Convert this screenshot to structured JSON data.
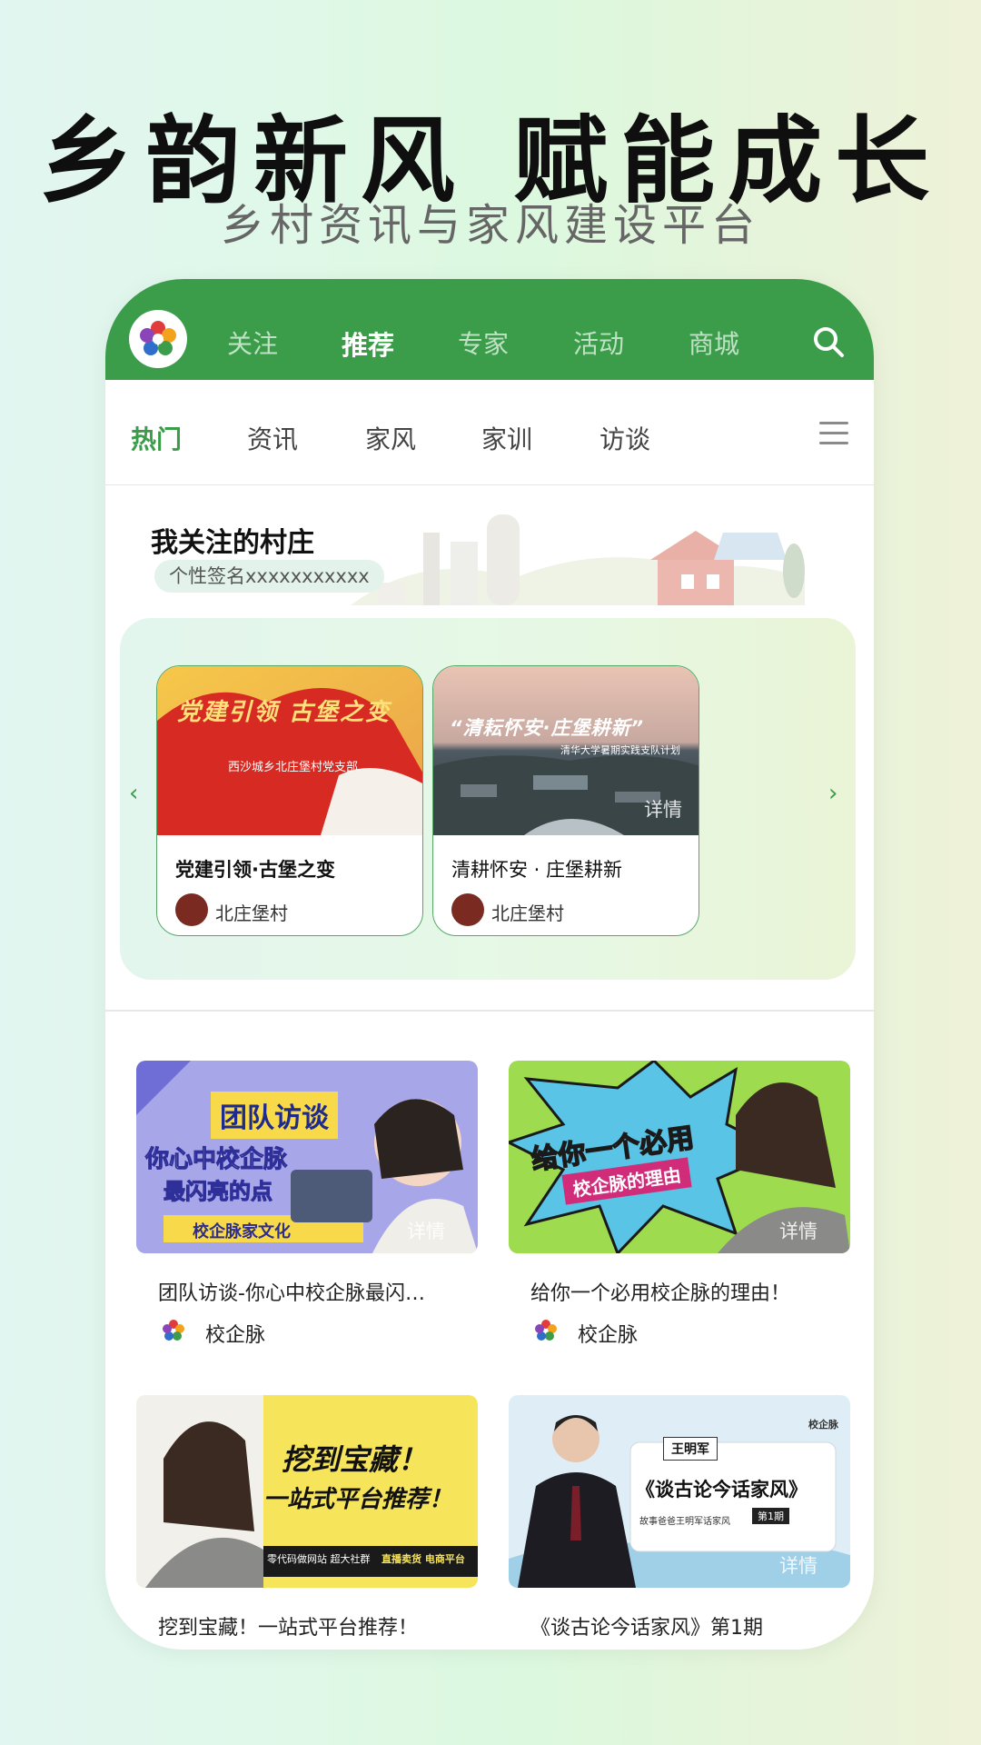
{
  "hero": {
    "title": "乡韵新风 赋能成长",
    "subtitle": "乡村资讯与家风建设平台"
  },
  "top_nav": {
    "tabs": [
      "关注",
      "推荐",
      "专家",
      "活动",
      "商城"
    ],
    "active_index": 1,
    "color": "#3b9d4a"
  },
  "sub_nav": {
    "tabs": [
      "热门",
      "资讯",
      "家风",
      "家训",
      "访谈"
    ],
    "active_index": 0
  },
  "village": {
    "title": "我关注的村庄",
    "signature": "个性签名xxxxxxxxxxx",
    "cards": [
      {
        "thumb_text": "党建引领 古堡之变",
        "thumb_caption": "西沙城乡北庄堡村党支部",
        "title": "党建引领·古堡之变",
        "author": "北庄堡村"
      },
      {
        "thumb_text": "“清耘怀安·庄堡耕新”",
        "thumb_caption": "清华大学暑期实践支队计划",
        "detail": "详情",
        "title": "清耕怀安 · 庄堡耕新",
        "author": "北庄堡村"
      }
    ],
    "arrow_left": "‹",
    "arrow_right": "›"
  },
  "feed": [
    {
      "thumb": {
        "badge": "团队访谈",
        "line1": "你心中校企脉",
        "line2": "最闪亮的点",
        "banner": "校企脉家文化"
      },
      "detail": "详情",
      "title": "团队访谈-你心中校企脉最闪…",
      "author": "校企脉"
    },
    {
      "thumb": {
        "line1": "给你一个必用",
        "line2": "校企脉的理由"
      },
      "detail": "详情",
      "title": "给你一个必用校企脉的理由！",
      "author": "校企脉"
    },
    {
      "thumb": {
        "line1": "挖到宝藏！",
        "line2": "一站式平台推荐！",
        "footer_a": "零代码做网站 超大社群",
        "footer_b": "直播卖货 电商平台"
      },
      "title": "挖到宝藏！一站式平台推荐！"
    },
    {
      "thumb": {
        "name_tag": "王明军",
        "headline": "《谈古论今话家风》",
        "caption": "故事爸爸王明军话家风",
        "episode": "第1期",
        "brand": "校企脉"
      },
      "detail": "详情",
      "title": "《谈古论今话家风》第1期"
    }
  ]
}
